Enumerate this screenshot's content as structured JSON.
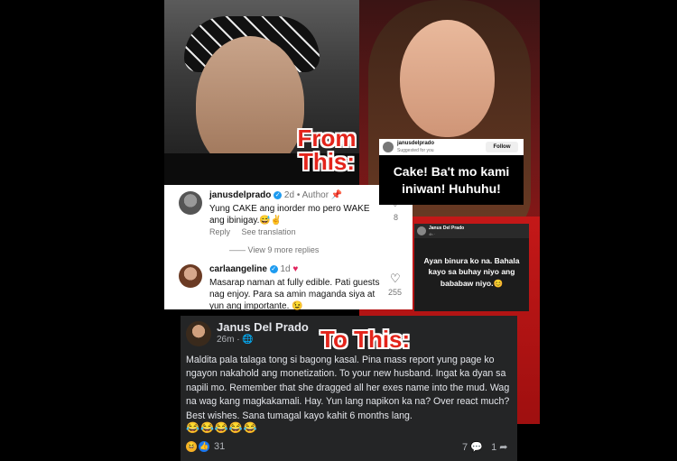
{
  "labels": {
    "from_this": "From This:",
    "to_this": "To This:"
  },
  "instagram": {
    "comment1": {
      "username": "janusdelprado",
      "age": "2d",
      "author_tag": "Author",
      "text": "Yung CAKE ang inorder mo pero WAKE ang ibinigay.😅✌️",
      "reply": "Reply",
      "see_translation": "See translation",
      "likes": "8"
    },
    "view_replies": "View 9 more replies",
    "comment2": {
      "username": "carlaangeline",
      "age": "1d",
      "text": "Masarap naman at fully edible. Pati guests nag enjoy. Para sa amin maganda siya at yun ang importante. 😉",
      "likes": "255"
    }
  },
  "suggested": {
    "username": "janusdelprado",
    "subtitle": "Suggested for you",
    "follow_label": "Follow"
  },
  "cake_caption": "Cake! Ba't mo kami iniwan! Huhuhu!",
  "fb_small": {
    "name": "Janus Del Prado",
    "meta": "4h ·",
    "message": "Ayan binura ko na. Bahala kayo sa buhay niyo ang bababaw niyo.😊"
  },
  "fb_post": {
    "name": "Janus Del Prado",
    "meta": "26m · 🌐",
    "text": "Maldita pala talaga tong si bagong kasal. Pina mass report yung page ko ngayon nakahold ang monetization. To your new husband. Ingat ka dyan sa napili mo. Remember that she dragged all her exes name into the mud. Wag na wag kang magkakamali. Hay. Yun lang napikon ka na? Over react much? Best wishes. Sana tumagal kayo kahit 6 months lang.",
    "emojis": "😂😂😂😂😂",
    "reaction_count": "31",
    "comment_count": "7",
    "share_count": "1"
  }
}
